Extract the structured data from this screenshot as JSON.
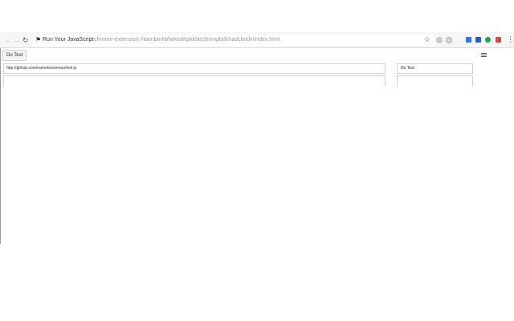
{
  "browser": {
    "extension_name": "Run Your JavaScript",
    "url": "chrome-extension://iaenbmhbhekeahpkkbecjlmmpbdkhadcbodv/index.html",
    "back_icon": "back-arrow-icon",
    "forward_icon": "forward-arrow-icon",
    "reload_icon": "reload-icon",
    "bookmark_icon": "star-icon",
    "menu_icon": "more-vert-icon"
  },
  "page": {
    "top_button_label": "Do Test",
    "url_input_value": "http://github.com/nameboomman/test.js",
    "side_button_label": "Do Test",
    "menu_icon": "list-icon"
  },
  "colors": {
    "toolbar_bg": "#f6f6f6",
    "border": "#cfcfcf",
    "ext_blue": "#3b73d8",
    "ext_green": "#21a152",
    "ext_red": "#d34a3c"
  }
}
